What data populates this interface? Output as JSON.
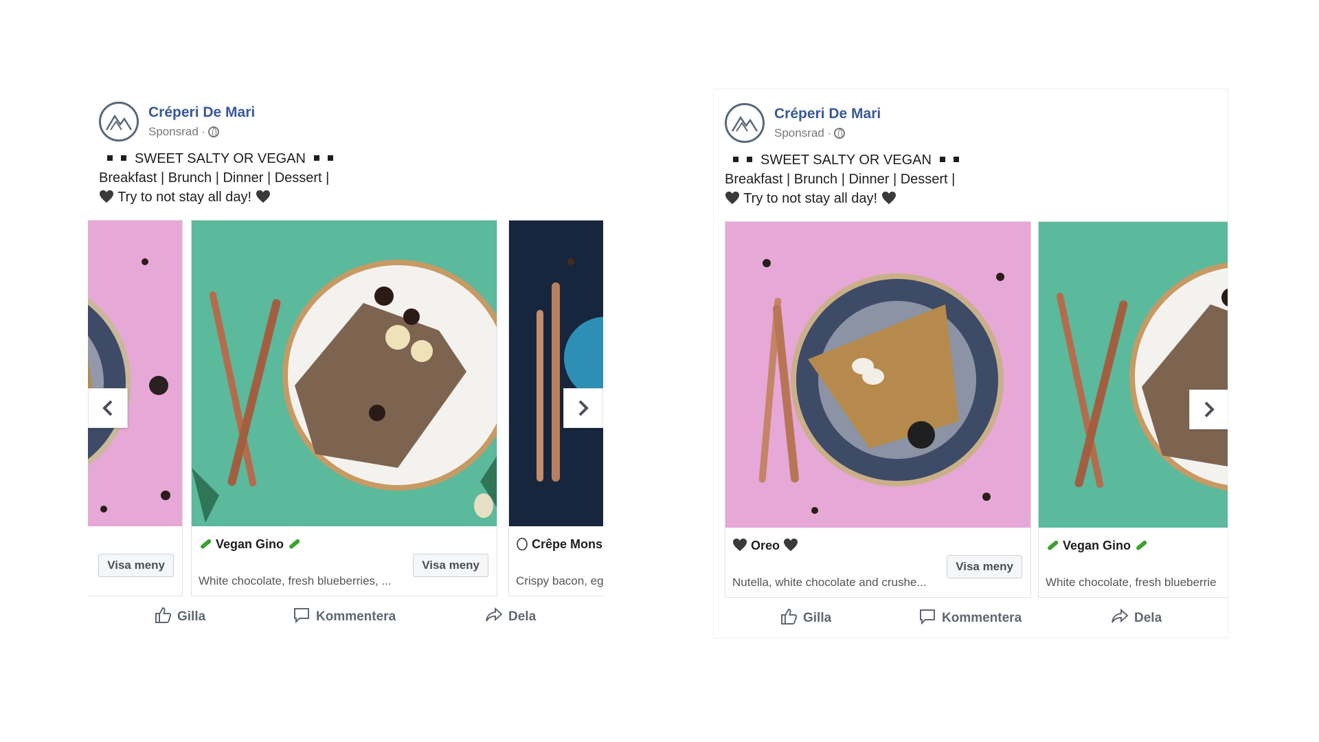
{
  "colors": {
    "brand_link": "#385898",
    "pink_bg": "#e6a8d6",
    "teal_bg": "#5bb99c",
    "navy_bg": "#18263d"
  },
  "post_left": {
    "page_name": "Créperi De Mari",
    "sponsored": "Sponsrad ·",
    "caption": {
      "line1": "SWEET SALTY OR VEGAN",
      "line2": "Breakfast | Brunch | Dinner | Dessert |",
      "line3": "Try to not stay all day!"
    },
    "cards": [
      {
        "title": "",
        "description": "",
        "button": "Visa meny"
      },
      {
        "title": "Vegan Gino",
        "description": "White chocolate, fresh blueberries, ...",
        "button": "Visa meny"
      },
      {
        "title": "Crêpe Mons",
        "description": "Crispy bacon, eg",
        "button": ""
      }
    ],
    "actions": {
      "like": "Gilla",
      "comment": "Kommentera",
      "share": "Dela"
    }
  },
  "post_right": {
    "page_name": "Créperi De Mari",
    "sponsored": "Sponsrad ·",
    "caption": {
      "line1": "SWEET SALTY OR VEGAN",
      "line2": "Breakfast | Brunch | Dinner | Dessert |",
      "line3": "Try to not stay all day!"
    },
    "cards": [
      {
        "title": "Oreo",
        "description": "Nutella, white chocolate and crushe...",
        "button": "Visa meny"
      },
      {
        "title": "Vegan Gino",
        "description": "White chocolate, fresh blueberrie",
        "button": ""
      }
    ],
    "actions": {
      "like": "Gilla",
      "comment": "Kommentera",
      "share": "Dela"
    }
  }
}
